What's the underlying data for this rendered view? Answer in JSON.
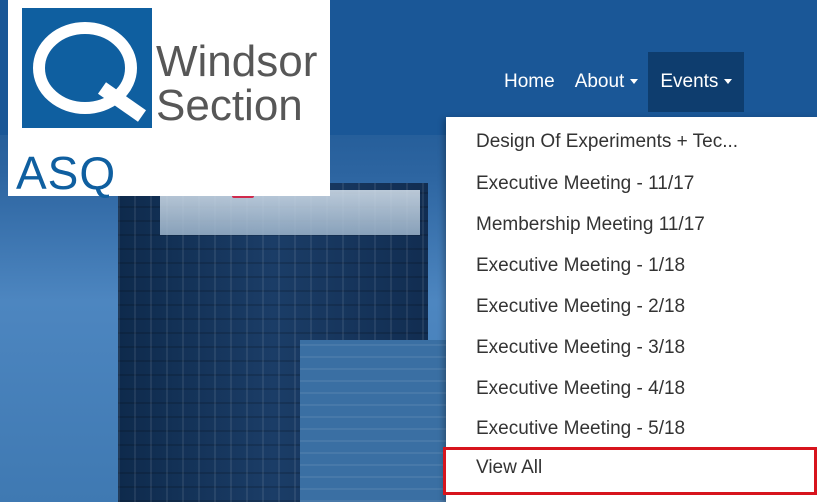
{
  "logo": {
    "title_line1": "Windsor",
    "title_line2": "Section",
    "org": "ASQ"
  },
  "nav": {
    "home": "Home",
    "about": "About",
    "events": "Events"
  },
  "events_menu": [
    "Design Of Experiments + Tec...",
    "Executive Meeting - 11/17",
    "Membership Meeting 11/17",
    "Executive Meeting - 1/18",
    "Executive Meeting - 2/18",
    "Executive Meeting - 3/18",
    "Executive Meeting - 4/18",
    "Executive Meeting - 5/18",
    "View All"
  ],
  "colors": {
    "header": "#1a5797",
    "active_nav": "#0e3d6e",
    "logo_blue": "#0f5fa0",
    "highlight": "#d7141d"
  }
}
